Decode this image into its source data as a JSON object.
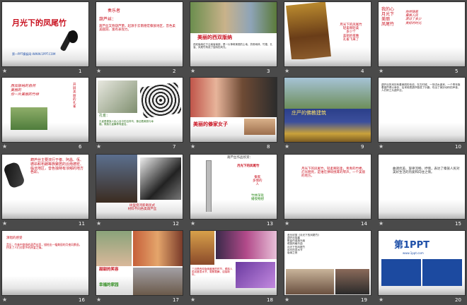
{
  "slides": [
    {
      "n": "1",
      "title": "月光下的凤尾竹",
      "footer": "第一PPT模板网-WWW.1PPT.COM"
    },
    {
      "n": "2",
      "label": "奏乐者",
      "heading": "葫芦丝：",
      "body": "葫芦丝又称葫芦箫，起源于云南德宏傣族地区，音色柔美圆润、富有表现力。"
    },
    {
      "n": "3",
      "caption": "美丽的西双版纳",
      "body": "西双版纳位于云南省南部，是一片神奇美丽的土地，热带雨林、竹楼、孔雀、凤尾竹构成了独特的风光。"
    },
    {
      "n": "4",
      "poem": "月光下的凤尾竹\n轻柔啊轻柔\n多少个\n美丽的夜晚\n孔雀飞来了"
    },
    {
      "n": "5",
      "poem": "他伴随着\n傣族人民\n渡过了多少\n美好的时光",
      "side": "我的心\n月光下\n美丽\n凤尾竹"
    },
    {
      "n": "6",
      "lines": "西双版纳的自然\n美丽的\n你一片美丽的竹林",
      "side": "开\n屏\n美\n丽\n的\n孔\n雀"
    },
    {
      "n": "7",
      "label": "孔雀：",
      "body": "孔雀是傣族人民心目中的吉祥鸟，象征着美丽与幸福，傣族孔雀舞享有盛名。"
    },
    {
      "n": "8",
      "caption": "美丽的傣家女子"
    },
    {
      "n": "9",
      "caption": "庄严的佛教建筑"
    },
    {
      "n": "10",
      "body": "葫芦丝的来历有着美丽的传说。在古时候，一场洪水袭来，一个青年抱着葫芦得以幸存，后来他把葫芦做成了乐器，吹出了美妙动听的声音，人们称之为葫芦丝。"
    },
    {
      "n": "11",
      "body": "葫芦丝主要流行于傣、阿昌、佤、德昂和布朗等族聚居的云南德宏、临沧地区，音色独特有浓郁的地方色彩。"
    },
    {
      "n": "12",
      "caption": "树里傍鸿新奇民式\n材料不同各类葫芦丝"
    },
    {
      "n": "13",
      "label": "葫芦丝作品欣赏：",
      "title": "月光下的凤尾竹",
      "links": [
        "傣家\n多情的\n人",
        "竹林深处\n婚夜畅想"
      ]
    },
    {
      "n": "14",
      "body": "月光下的凤尾竹，轻柔啊轻柔，青青的竹楼，灯光明亮，是谁在弹响悦耳的琴声，一个美丽的地方。"
    },
    {
      "n": "15",
      "body": "曲调优美、旋律流畅、抒情，表达了傣族人民对美好生活的热爱和向往之情。"
    },
    {
      "n": "16",
      "label": "演唱的感受",
      "body": "音乐：竹林中悠扬的葫芦丝声，描绘出一幅美丽的月夜风景画，抒发了人们对家乡的热爱之情。"
    },
    {
      "n": "17",
      "caption1": "甜甜的笑容",
      "caption2": "幸福的家园"
    },
    {
      "n": "18",
      "body": "三月是西双版纳最美的时节，傣族人民欢度泼水节，载歌载舞，迎接新年。"
    },
    {
      "n": "19",
      "body": "音乐欣赏《月光下的凤尾竹》\n葫芦丝独奏\n歌曲作者施光南\n傣族风格乐曲\n月光下的凤尾竹\n欢乐的泼水节\n版纳之夜"
    },
    {
      "n": "20",
      "brand": "第1PPT",
      "brand_sub": "www.1ppt.com"
    }
  ],
  "colors": {
    "title_red": "#c8101e",
    "bg": "#4a4a4a",
    "footer_blue": "#1e4fa8"
  }
}
